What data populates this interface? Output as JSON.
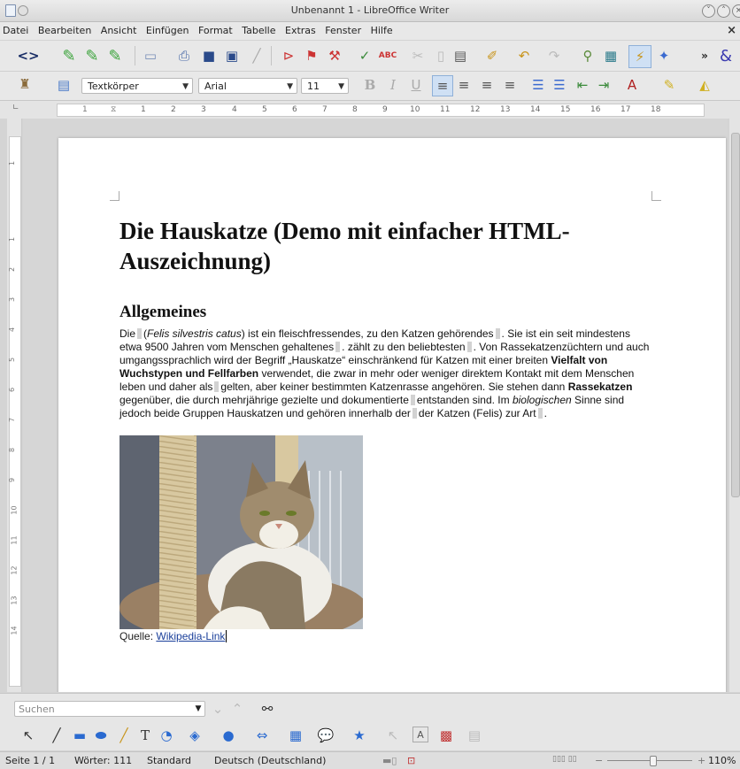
{
  "window": {
    "title": "Unbenannt 1 - LibreOffice Writer"
  },
  "menu": {
    "items": [
      "Datei",
      "Bearbeiten",
      "Ansicht",
      "Einfügen",
      "Format",
      "Tabelle",
      "Extras",
      "Fenster",
      "Hilfe"
    ]
  },
  "formatting": {
    "style": "Textkörper",
    "font": "Arial",
    "size": "11"
  },
  "document": {
    "title": "Die Hauskatze (Demo mit einfacher HTML-Auszeichnung)",
    "heading": "Allgemeines",
    "p": {
      "a1": "Die",
      "a2": "(",
      "a3": "Felis silvestris catus",
      "a4": ") ist ein fleischfressendes, zu den Katzen gehörendes",
      "a5": ". Sie ist ein seit mindestens etwa 9500 Jahren vom Menschen gehaltenes",
      "a6": ". zählt zu den beliebtesten",
      "a7": ". Von Rassekatzenzüchtern und auch umgangssprachlich wird der Begriff „Hauskatze“ einschränkend für Katzen mit einer breiten",
      "b1": "Vielfalt von Wuchstypen und Fellfarben",
      "a8": "verwendet, die zwar in mehr oder weniger direktem Kontakt mit dem Menschen leben und daher als",
      "a9": "gelten, aber keiner bestimmten Katzenrasse angehören. Sie stehen dann",
      "b2": "Rassekatzen",
      "a10": "gegenüber, die durch mehrjährige gezielte und dokumentierte",
      "a11": "entstanden sind. Im",
      "i2": "biologischen",
      "a12": "Sinne sind jedoch beide Gruppen Hauskatzen und gehören innerhalb der",
      "a13": "der Katzen (Felis) zur Art",
      "a14": "."
    },
    "caption_label": "Quelle:",
    "caption_link": "Wikipedia-Link"
  },
  "find": {
    "placeholder": "Suchen"
  },
  "status": {
    "page": "Seite 1 / 1",
    "words": "Wörter: 111",
    "style": "Standard",
    "language": "Deutsch (Deutschland)",
    "zoom": "110%"
  }
}
